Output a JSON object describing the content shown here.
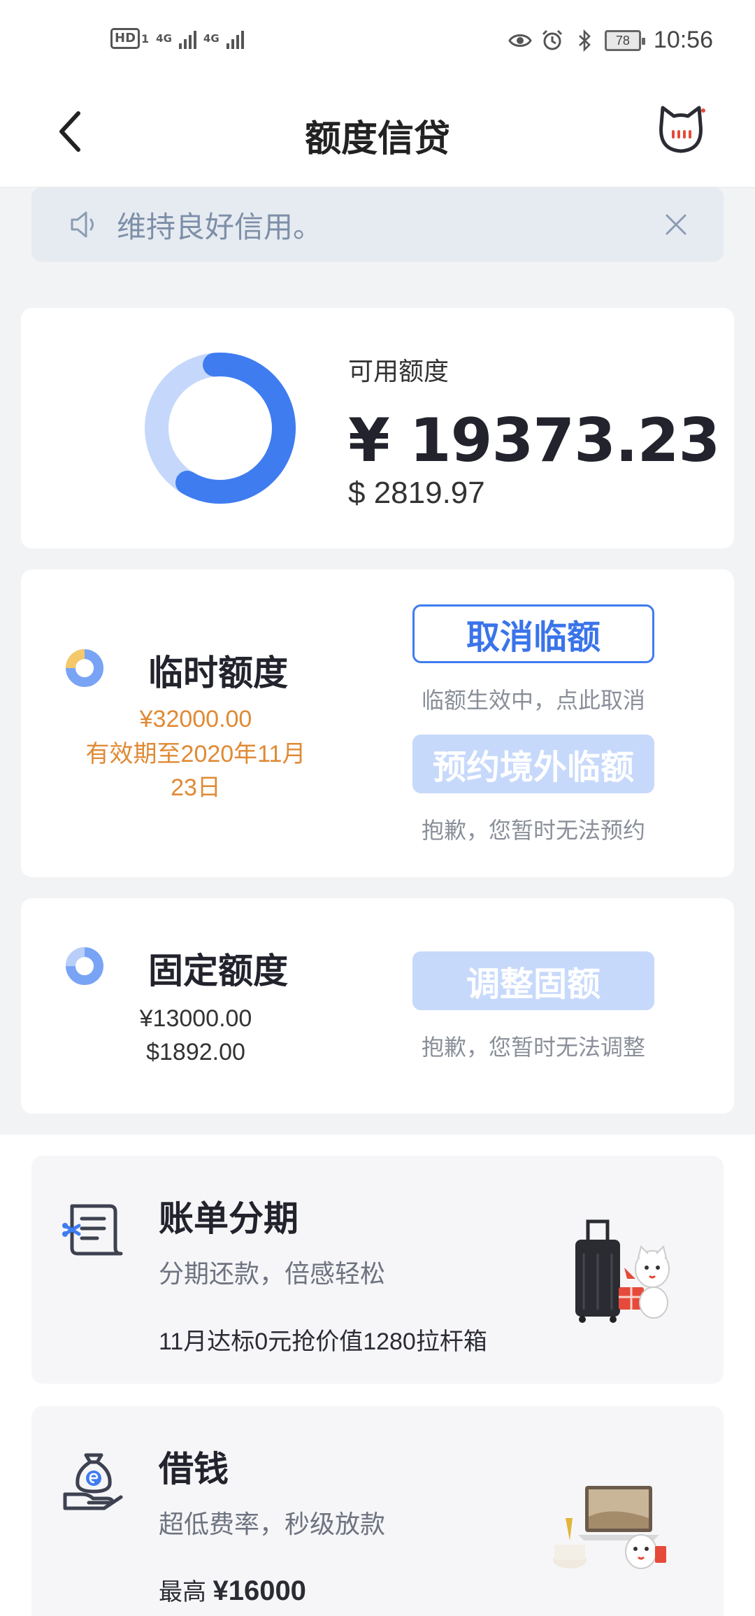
{
  "status_bar": {
    "hd_label": "HD",
    "hd_sub": "1",
    "signal_1": "4G",
    "signal_2": "4G",
    "battery": "78",
    "time": "10:56"
  },
  "nav": {
    "title": "额度信贷",
    "back_icon": "chevron-left-icon",
    "assistant_icon": "cat-assistant-icon"
  },
  "notice": {
    "icon": "speaker-icon",
    "text": "维持良好信用。"
  },
  "available": {
    "label": "可用额度",
    "cny": "¥ 19373.23",
    "usd": "$ 2819.97",
    "used_fraction": 0.4
  },
  "temp_quota": {
    "title": "临时额度",
    "amount": "¥32000.00",
    "validity_line1": "有效期至2020年11月",
    "validity_line2": "23日",
    "button_label": "取消临额",
    "button_note": "临额生效中，点此取消",
    "button2_label": "预约境外临额",
    "button2_note": "抱歉，您暂时无法预约"
  },
  "fixed_quota": {
    "title": "固定额度",
    "amount_cny": "¥13000.00",
    "amount_usd": "$1892.00",
    "button_label": "调整固额",
    "button_note": "抱歉，您暂时无法调整"
  },
  "promos": [
    {
      "title": "账单分期",
      "subtitle": "分期还款，倍感轻松",
      "footer": "11月达标0元抢价值1280拉杆箱",
      "icon": "bill-installment-icon",
      "art": "luggage-illustration"
    },
    {
      "title": "借钱",
      "subtitle": "超低费率，秒级放款",
      "footer_prefix": "最高",
      "footer_amount": "¥16000",
      "icon": "money-bag-hand-icon",
      "art": "laptop-illustration"
    }
  ],
  "colors": {
    "accent": "#3f7cf0",
    "accent_light": "#c7d9fb",
    "orange": "#e08a35",
    "temp_donut_segment": "#f5c86a"
  }
}
